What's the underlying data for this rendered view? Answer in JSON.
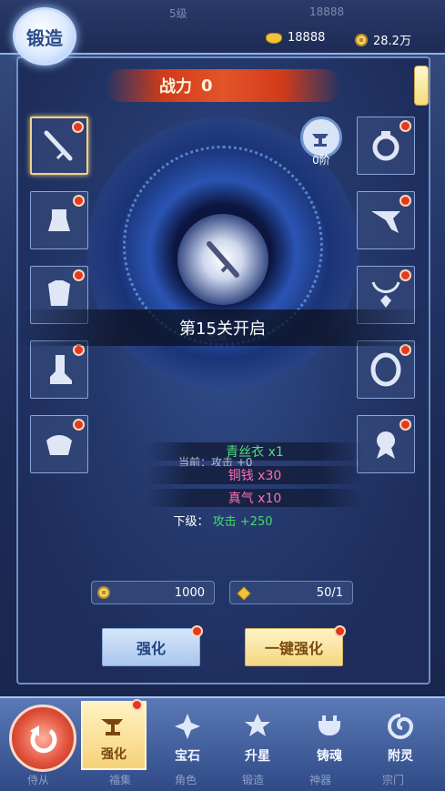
{
  "header": {
    "title": "锻造",
    "faded_level": "5级",
    "faded_gold": "18888",
    "gold_ingot": "18888",
    "copper": "28.2万"
  },
  "power": {
    "label": "战力",
    "value": "0"
  },
  "stage": {
    "label": "0阶"
  },
  "unlock_message": "第15关开启",
  "center_item": {
    "faded_label": "武器"
  },
  "costs": [
    {
      "text": "青丝衣 x1",
      "color": "#4be07a"
    },
    {
      "text": "铜钱 x30",
      "color": "#ff6fb0"
    },
    {
      "text": "真气 x10",
      "color": "#ff6fb0"
    }
  ],
  "current_stat": {
    "label": "当前：",
    "value": "攻击 +0"
  },
  "next_stat": {
    "label": "下级：",
    "stat": "攻击",
    "value": "+250"
  },
  "fields": {
    "copper_cost": "1000",
    "stones": "50/1"
  },
  "buttons": {
    "enhance": "强化",
    "one_click": "一键强化"
  },
  "tabs": [
    {
      "label": "强化",
      "icon": "anvil-icon",
      "active": true,
      "badge": true
    },
    {
      "label": "宝石",
      "icon": "gem-icon",
      "active": false
    },
    {
      "label": "升星",
      "icon": "star-icon",
      "active": false
    },
    {
      "label": "铸魂",
      "icon": "cauldron-icon",
      "active": false
    },
    {
      "label": "附灵",
      "icon": "swirl-icon",
      "active": false
    }
  ],
  "under_tabs": [
    "侍从",
    "福集",
    "角色",
    "锻造",
    "神器",
    "宗门"
  ],
  "equipment_left": [
    "sword-icon",
    "helmet-icon",
    "armor-icon",
    "boots-icon",
    "belt-icon"
  ],
  "equipment_right": [
    "ring-icon",
    "scarf-icon",
    "necklace-icon",
    "bracelet-icon",
    "pendant-icon"
  ]
}
